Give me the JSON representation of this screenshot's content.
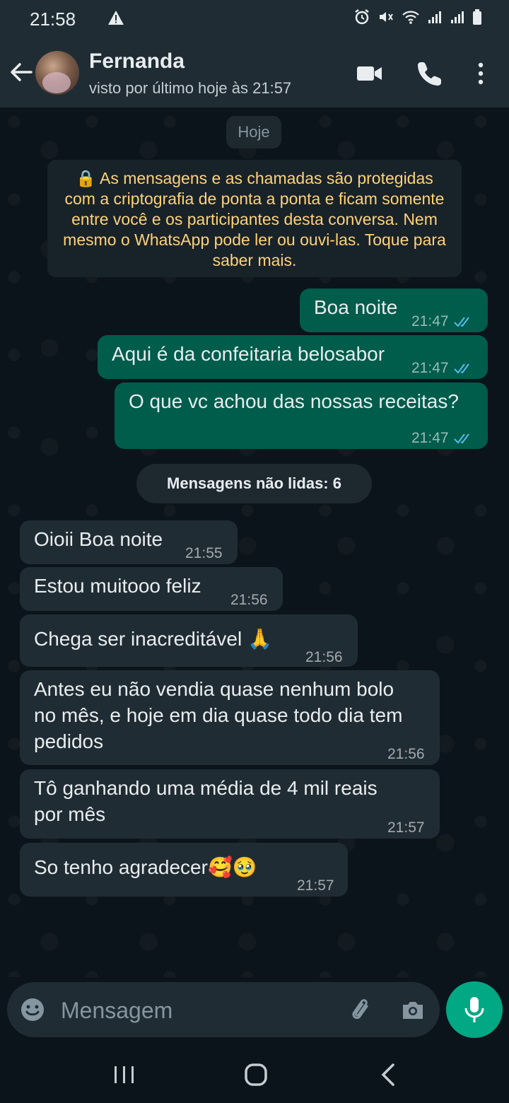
{
  "status_bar": {
    "time": "21:58"
  },
  "header": {
    "contact_name": "Fernanda",
    "last_seen": "visto por último hoje às 21:57"
  },
  "chat": {
    "date_chip": "Hoje",
    "encryption_notice": "🔒 As mensagens e as chamadas são protegidas com a criptografia de ponta a ponta e ficam somente entre você e os participantes desta conversa. Nem mesmo o WhatsApp pode ler ou ouvi-las. Toque para saber mais.",
    "unread_label": "Mensagens não lidas: 6",
    "outgoing": [
      {
        "text": "Boa noite",
        "time": "21:47"
      },
      {
        "text": "Aqui é da confeitaria belosabor",
        "time": "21:47"
      },
      {
        "text": "O que vc achou das nossas receitas?",
        "time": "21:47"
      }
    ],
    "incoming": [
      {
        "text": "Oioii Boa noite",
        "time": "21:55"
      },
      {
        "text": "Estou muitooo feliz",
        "time": "21:56"
      },
      {
        "text": "Chega ser inacreditável 🙏",
        "time": "21:56"
      },
      {
        "text_line1": "Antes eu não vendia quase nenhum bolo",
        "text_line2": "no mês, e hoje em dia quase todo dia tem",
        "text_line3": "pedidos",
        "time": "21:56"
      },
      {
        "text_line1": "Tô ganhando uma média de 4 mil reais",
        "text_line2": "por mês",
        "time": "21:57"
      },
      {
        "text": "So tenho agradecer🥰🥹",
        "time": "21:57"
      }
    ]
  },
  "input": {
    "placeholder": "Mensagem"
  },
  "colors": {
    "accent": "#00a884",
    "outgoing_bubble": "#005c4b",
    "incoming_bubble": "#202c33",
    "read_ticks": "#53bdeb"
  }
}
